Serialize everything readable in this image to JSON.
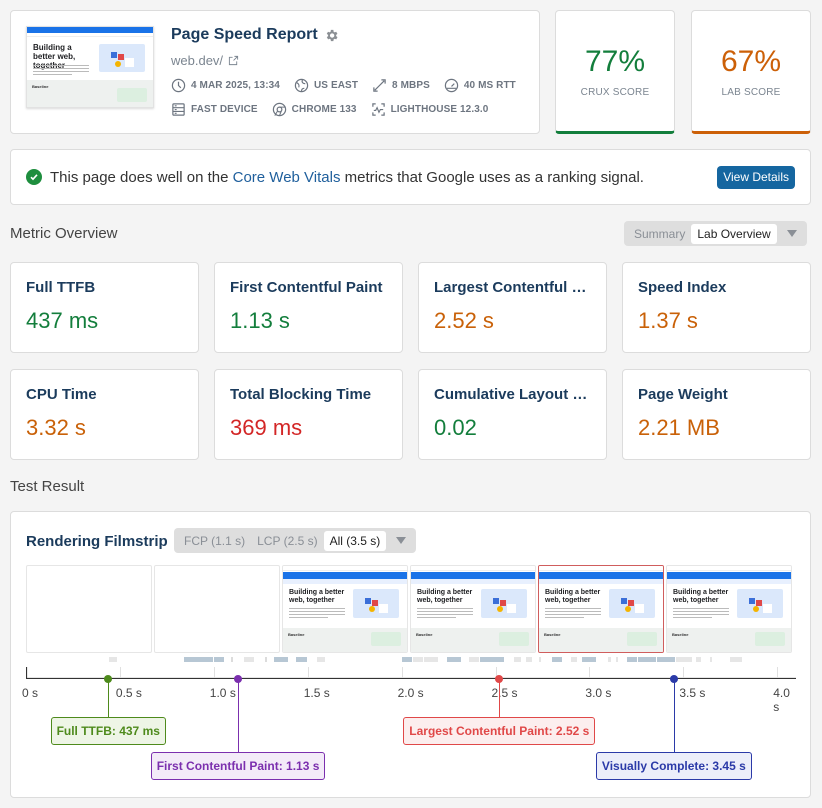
{
  "header": {
    "title": "Page Speed Report",
    "url": "web.dev/",
    "thumbnail": {
      "heading": "Building a better web, together",
      "badge": "Baseline",
      "section": "Baseline"
    },
    "meta": [
      {
        "icon": "clock-icon",
        "label": "4 MAR 2025, 13:34"
      },
      {
        "icon": "globe-icon",
        "label": "US EAST"
      },
      {
        "icon": "bandwidth-icon",
        "label": "8 MBPS"
      },
      {
        "icon": "gauge-icon",
        "label": "40 MS RTT"
      },
      {
        "icon": "device-icon",
        "label": "FAST DEVICE"
      },
      {
        "icon": "chrome-icon",
        "label": "CHROME 133"
      },
      {
        "icon": "lighthouse-icon",
        "label": "LIGHTHOUSE 12.3.0"
      }
    ]
  },
  "scores": {
    "crux": {
      "value": "77%",
      "label": "CRUX SCORE",
      "color": "#137e3c"
    },
    "lab": {
      "value": "67%",
      "label": "LAB SCORE",
      "color": "#cc6008"
    }
  },
  "banner": {
    "text_before": "This page does well on the ",
    "link": "Core Web Vitals",
    "text_after": " metrics that Google uses as a ranking signal.",
    "button": "View Details"
  },
  "metric_overview": {
    "title": "Metric Overview",
    "toggle": {
      "options": [
        "Summary",
        "Lab Overview"
      ],
      "selected": "Lab Overview"
    },
    "metrics": [
      {
        "label": "Full TTFB",
        "value": "437 ms",
        "rating": "good"
      },
      {
        "label": "First Contentful Paint",
        "value": "1.13 s",
        "rating": "good"
      },
      {
        "label": "Largest Contentful Paint",
        "value": "2.52 s",
        "rating": "avg"
      },
      {
        "label": "Speed Index",
        "value": "1.37 s",
        "rating": "avg"
      },
      {
        "label": "CPU Time",
        "value": "3.32 s",
        "rating": "avg"
      },
      {
        "label": "Total Blocking Time",
        "value": "369 ms",
        "rating": "poor"
      },
      {
        "label": "Cumulative Layout Shift",
        "value": "0.02",
        "rating": "good"
      },
      {
        "label": "Page Weight",
        "value": "2.21 MB",
        "rating": "avg"
      }
    ]
  },
  "test_result": {
    "title": "Test Result",
    "filmstrip": {
      "title": "Rendering Filmstrip",
      "toggle": {
        "options": [
          "FCP (1.1 s)",
          "LCP (2.5 s)",
          "All (3.5 s)"
        ],
        "selected": "All (3.5 s)"
      },
      "frames": [
        {
          "rendered": false,
          "highlight": false
        },
        {
          "rendered": false,
          "highlight": false
        },
        {
          "rendered": true,
          "highlight": false
        },
        {
          "rendered": true,
          "highlight": false
        },
        {
          "rendered": true,
          "highlight": true
        },
        {
          "rendered": true,
          "highlight": false
        }
      ],
      "axis": {
        "min": 0,
        "max": 4.1,
        "ticks": [
          "0 s",
          "0.5 s",
          "1.0 s",
          "1.5 s",
          "2.0 s",
          "2.5 s",
          "3.0 s",
          "3.5 s",
          "4.0 s"
        ],
        "tick_values": [
          0,
          0.5,
          1.0,
          1.5,
          2.0,
          2.5,
          3.0,
          3.5,
          4.0
        ]
      },
      "markers": [
        {
          "label": "Full TTFB: 437 ms",
          "time": 0.437,
          "color": "#4e8a1c",
          "bg": "#eef5e6",
          "row": 0
        },
        {
          "label": "First Contentful Paint: 1.13 s",
          "time": 1.13,
          "color": "#7b2fae",
          "bg": "#f3ebf8",
          "row": 1
        },
        {
          "label": "Largest Contentful Paint: 2.52 s",
          "time": 2.52,
          "color": "#e04848",
          "bg": "#fceeee",
          "row": 0
        },
        {
          "label": "Visually Complete: 3.45 s",
          "time": 3.45,
          "color": "#2b3aa8",
          "bg": "#eceefa",
          "row": 1
        }
      ],
      "requests": [
        [
          0.44,
          0.49,
          "#e6e6e6"
        ],
        [
          0.84,
          1.0,
          "#b7c7d4"
        ],
        [
          1.0,
          1.06,
          "#b7c7d4"
        ],
        [
          1.09,
          1.1,
          "#dcdcdc"
        ],
        [
          1.16,
          1.22,
          "#e6e6e6"
        ],
        [
          1.27,
          1.29,
          "#dcdcdc"
        ],
        [
          1.32,
          1.4,
          "#b7c7d4"
        ],
        [
          1.44,
          1.5,
          "#b7c7d4"
        ],
        [
          1.55,
          1.6,
          "#e6e6e6"
        ],
        [
          2.0,
          2.06,
          "#b7c7d4"
        ],
        [
          2.06,
          2.12,
          "#e6e6e6"
        ],
        [
          2.12,
          2.2,
          "#e6e6e6"
        ],
        [
          2.24,
          2.32,
          "#b7c7d4"
        ],
        [
          2.36,
          2.42,
          "#e6e6e6"
        ],
        [
          2.42,
          2.55,
          "#b7c7d4"
        ],
        [
          2.6,
          2.64,
          "#e6e6e6"
        ],
        [
          2.66,
          2.7,
          "#e6e6e6"
        ],
        [
          2.73,
          2.75,
          "#e6e6e6"
        ],
        [
          2.8,
          2.86,
          "#b7c7d4"
        ],
        [
          2.9,
          2.94,
          "#e6e6e6"
        ],
        [
          2.96,
          3.04,
          "#b7c7d4"
        ],
        [
          3.1,
          3.12,
          "#e6e6e6"
        ],
        [
          3.14,
          3.16,
          "#e6e6e6"
        ],
        [
          3.2,
          3.26,
          "#b7c7d4"
        ],
        [
          3.26,
          3.36,
          "#b7c7d4"
        ],
        [
          3.36,
          3.46,
          "#b7c7d4"
        ],
        [
          3.46,
          3.55,
          "#e6e6e6"
        ],
        [
          3.57,
          3.6,
          "#e6e6e6"
        ],
        [
          3.64,
          3.66,
          "#e6e6e6"
        ],
        [
          3.75,
          3.82,
          "#e6e6e6"
        ]
      ]
    }
  }
}
